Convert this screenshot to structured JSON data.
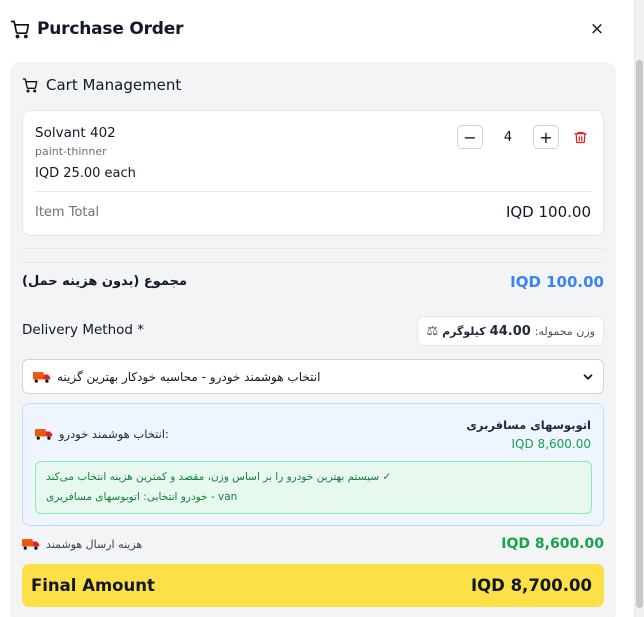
{
  "header": {
    "title": "Purchase Order",
    "close_icon": "×"
  },
  "cart": {
    "title": "Cart Management"
  },
  "item": {
    "name": "Solvant 402",
    "sku": "paint-thinner",
    "unit_price": "IQD 25.00 each",
    "quantity": "4",
    "minus": "−",
    "plus": "+",
    "total_label": "Item Total",
    "total_value": "IQD 100.00"
  },
  "subtotal": {
    "label": "مجموع (بدون هزینه حمل)",
    "value": "IQD 100.00"
  },
  "delivery": {
    "label": "Delivery Method *",
    "weight_prefix": "وزن محموله:",
    "weight_value": "44.00",
    "weight_unit": "کیلوگرم",
    "selected_option": "انتخاب هوشمند خودرو - محاسبه خودکار بهترین گزینه"
  },
  "smart": {
    "label": "انتخاب هوشمند خودرو:",
    "vehicle_name": "اتوبوسهای مسافربری",
    "vehicle_cost": "IQD 8,600.00",
    "note_line1": "سیستم بهترین خودرو را بر اساس وزن، مقصد و کمترین هزینه انتخاب می‌کند ✓",
    "note_line2": "خودرو انتخابی: اتوبوسهای مسافربری - van"
  },
  "shipping": {
    "label": "هزینه ارسال هوشمند",
    "value": "IQD 8,600.00"
  },
  "final": {
    "label": "Final Amount",
    "value": "IQD 8,700.00"
  },
  "colors": {
    "accent_blue": "#3b82f6",
    "accent_green": "#16a34a",
    "highlight_yellow": "#fde047",
    "danger_red": "#dc2626"
  },
  "icons": [
    "cart-icon",
    "close-icon",
    "trash-icon",
    "truck-icon",
    "scale-icon",
    "chevron-down-icon"
  ]
}
